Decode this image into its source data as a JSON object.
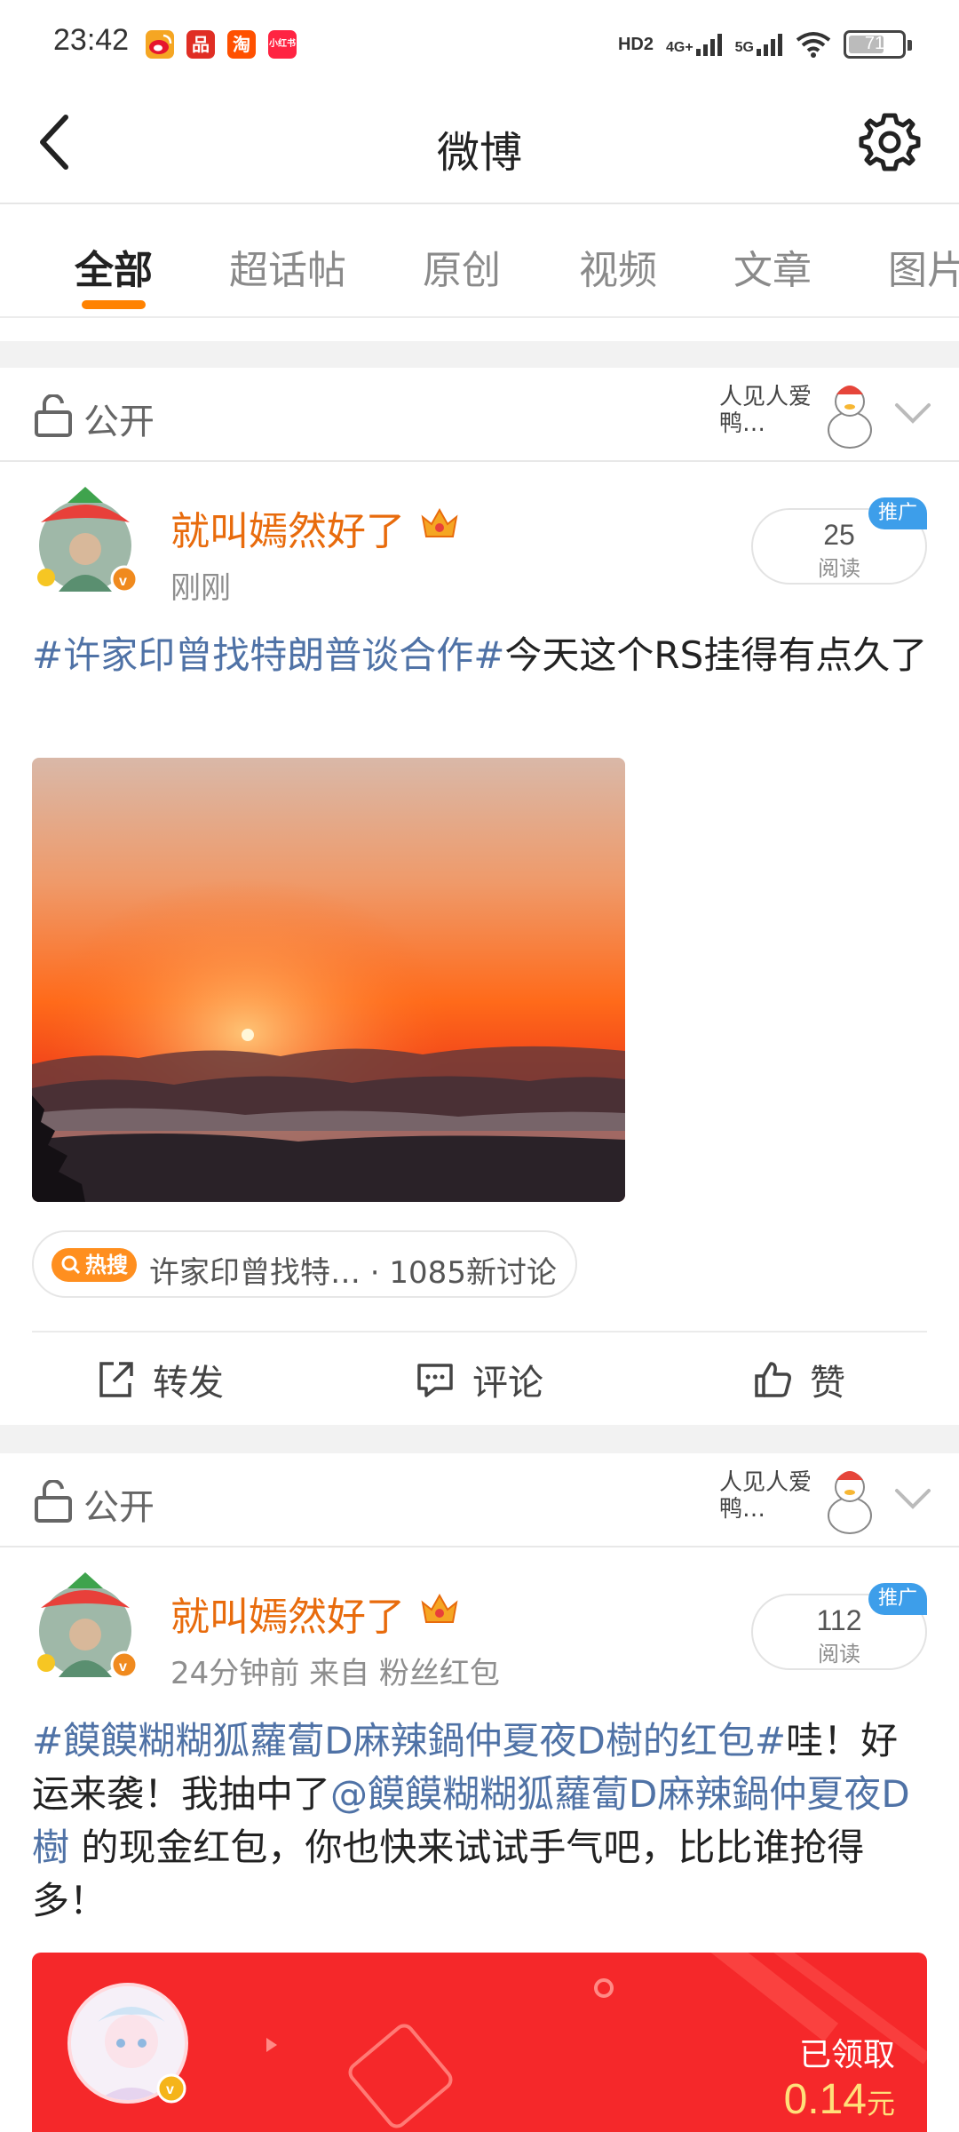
{
  "status_bar": {
    "time": "23:42",
    "apps": [
      {
        "icon": "weibo-app-icon",
        "color": "#f5a623"
      },
      {
        "icon": "pinduoduo-app-icon",
        "color": "#e02e24",
        "glyph": "品"
      },
      {
        "icon": "taobao-app-icon",
        "color": "#ff5000",
        "glyph": "淘"
      },
      {
        "icon": "xiaohongshu-app-icon",
        "color": "#ff2442",
        "glyph": "小红书"
      }
    ],
    "hd": "HD2",
    "net1": "4G+",
    "net2": "5G",
    "battery": "71"
  },
  "header": {
    "title": "微博"
  },
  "tabs": [
    "全部",
    "超话帖",
    "原创",
    "视频",
    "文章",
    "图片"
  ],
  "posts": [
    {
      "privacy": "公开",
      "sticker_text": "人见人爱 鸭…",
      "username": "就叫嫣然好了",
      "meta": "刚刚",
      "read_count": "25",
      "read_label": "阅读",
      "promo": "推广",
      "body_topic": "#许家印曾找特朗普谈合作#",
      "body_text": "今天这个RS挂得有点久了",
      "hot_badge": "热搜",
      "hot_text": "许家印曾找特… · 1085新讨论",
      "actions": {
        "repost": "转发",
        "comment": "评论",
        "like": "赞"
      }
    },
    {
      "privacy": "公开",
      "sticker_text": "人见人爱 鸭…",
      "username": "就叫嫣然好了",
      "meta": "24分钟前   来自 粉丝红包",
      "read_count": "112",
      "read_label": "阅读",
      "promo": "推广",
      "body_topic": "#饃饃糊糊狐蘿蔔D麻辣鍋仲夏夜D樹的红包#",
      "body_text1": "哇！好运来袭！我抽中了",
      "body_mention": "@饃饃糊糊狐蘿蔔D麻辣鍋仲夏夜D樹",
      "body_text2": " 的现金红包，你也快来试试手气吧，比比谁抢得多！",
      "packet_status": "已领取",
      "packet_amount": "0.14",
      "packet_unit": "元"
    }
  ],
  "colors": {
    "accent": "#ff8200",
    "username": "#e86b0c",
    "link": "#4f72a6",
    "packet": "#f5282a"
  }
}
